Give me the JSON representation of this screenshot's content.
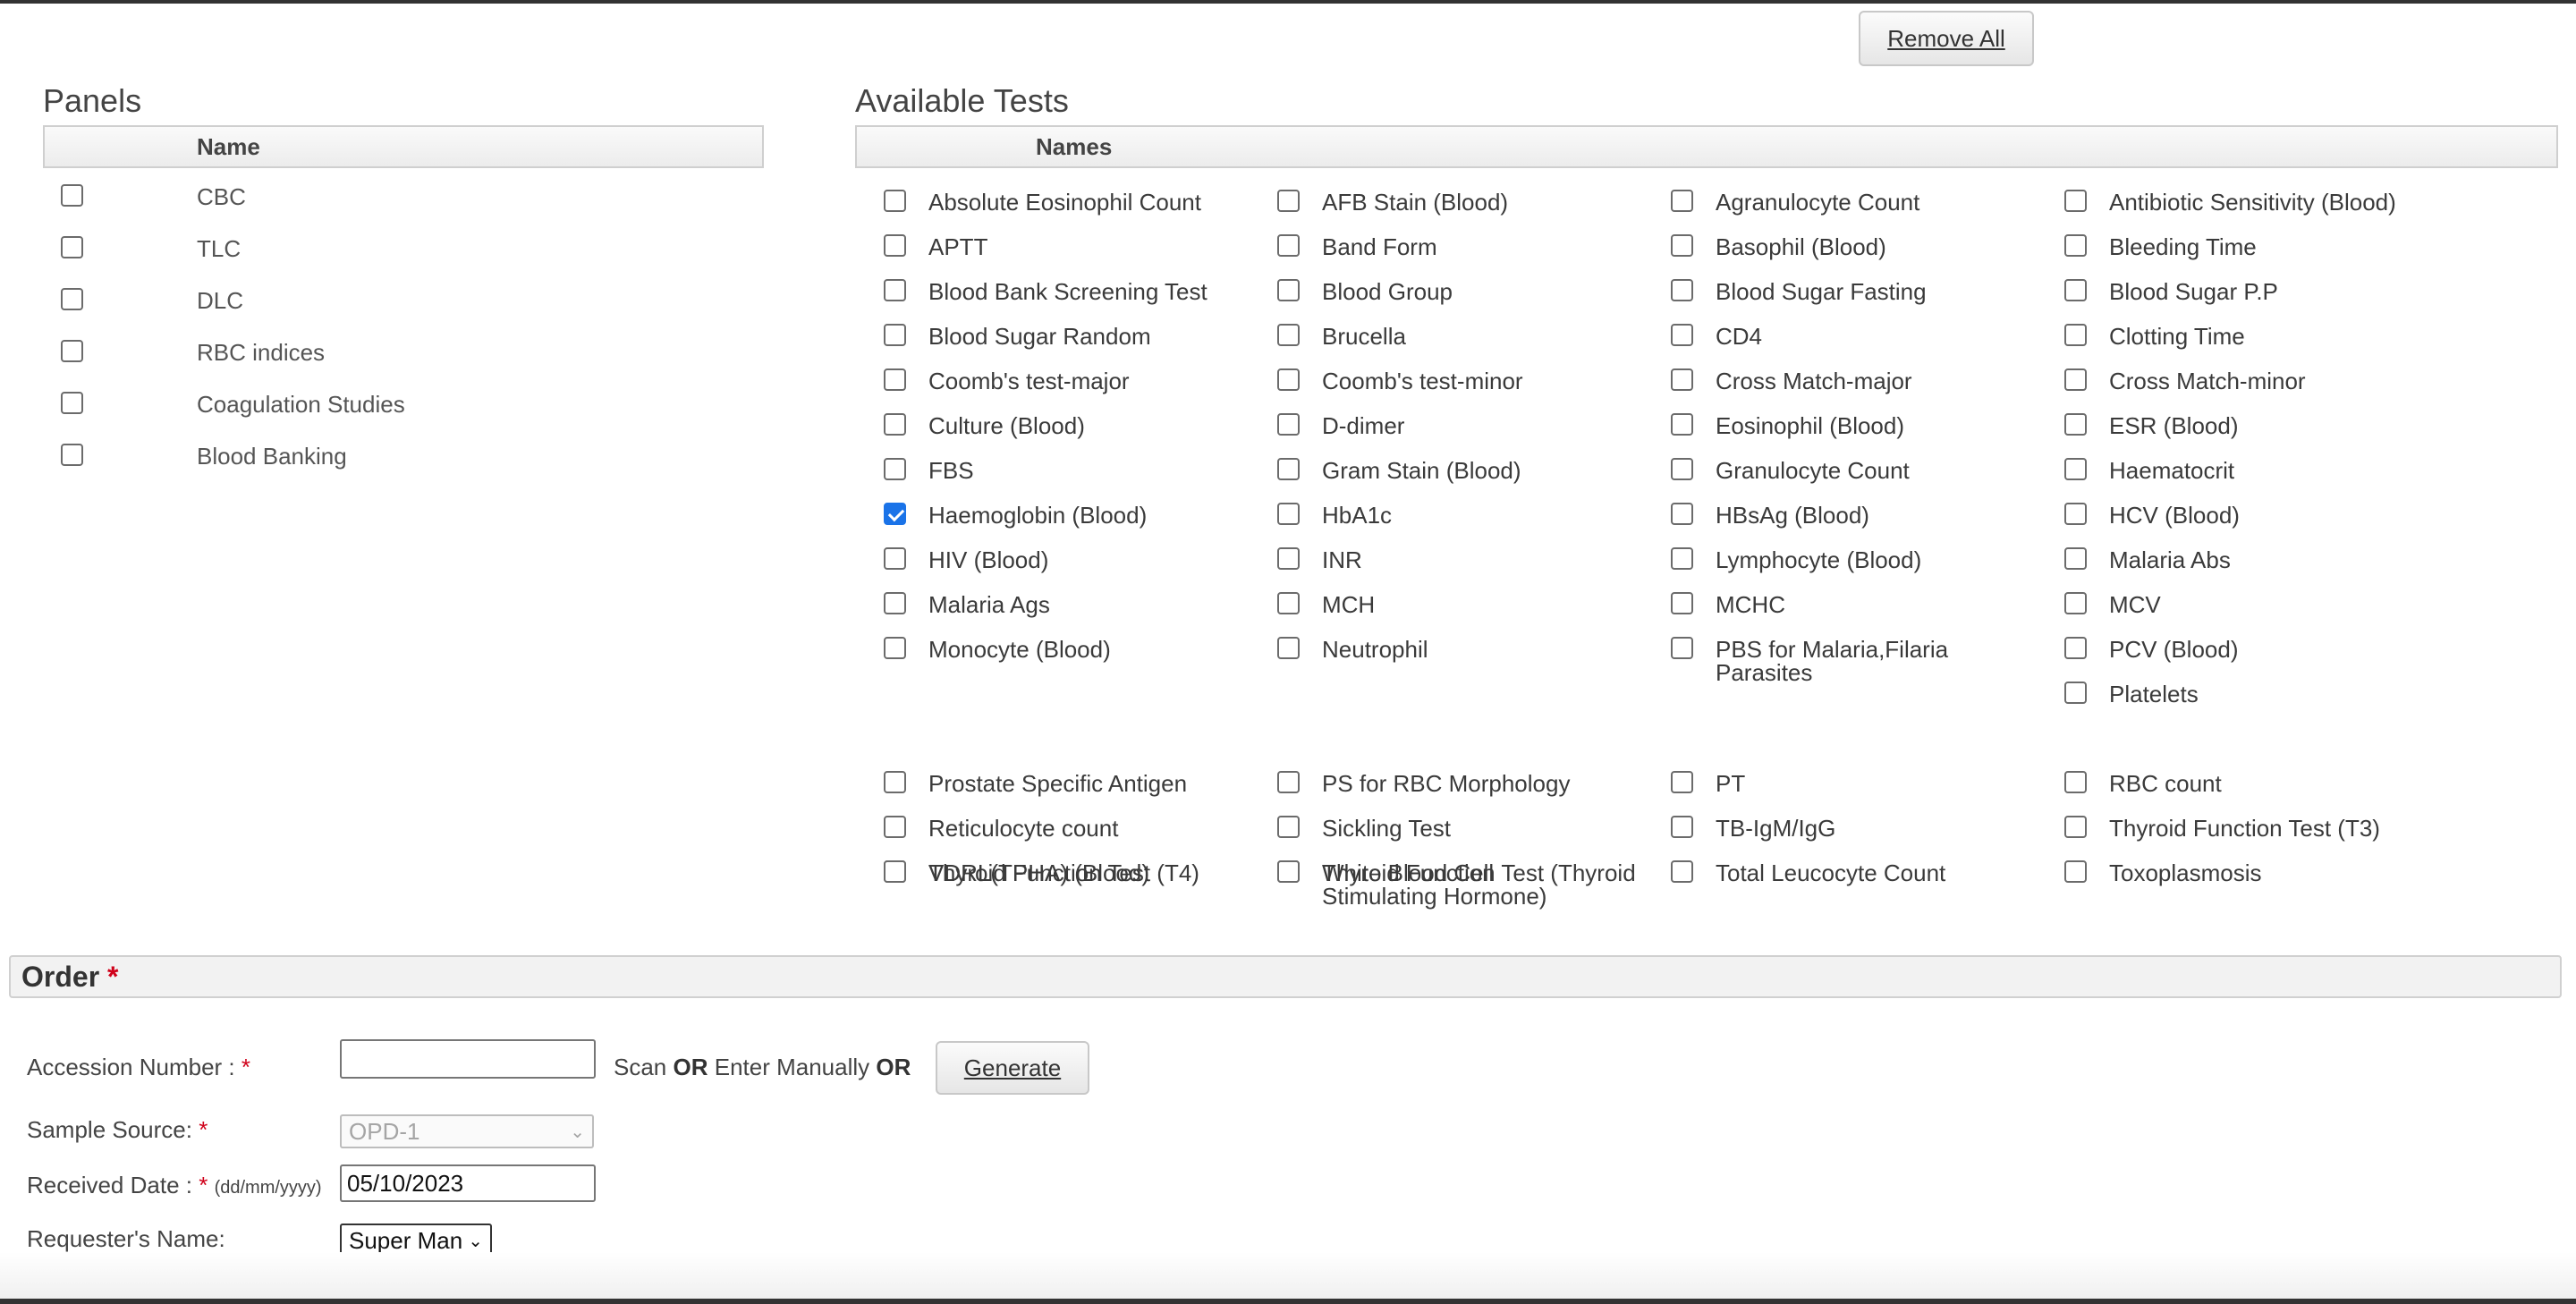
{
  "toolbar": {
    "remove_all_label": "Remove All"
  },
  "panels": {
    "title": "Panels",
    "column_header": "Name",
    "items": [
      {
        "label": "CBC",
        "checked": false
      },
      {
        "label": "TLC",
        "checked": false
      },
      {
        "label": "DLC",
        "checked": false
      },
      {
        "label": "RBC indices",
        "checked": false
      },
      {
        "label": "Coagulation Studies",
        "checked": false
      },
      {
        "label": "Blood Banking",
        "checked": false
      }
    ]
  },
  "tests": {
    "title": "Available Tests",
    "column_header": "Names",
    "items": [
      {
        "label": "Absolute Eosinophil Count",
        "checked": false
      },
      {
        "label": "AFB Stain (Blood)",
        "checked": false
      },
      {
        "label": "Agranulocyte Count",
        "checked": false
      },
      {
        "label": "Antibiotic Sensitivity (Blood)",
        "checked": false
      },
      {
        "label": "APTT",
        "checked": false
      },
      {
        "label": "Band Form",
        "checked": false
      },
      {
        "label": "Basophil (Blood)",
        "checked": false
      },
      {
        "label": "Bleeding Time",
        "checked": false
      },
      {
        "label": "Blood Bank Screening Test",
        "checked": false
      },
      {
        "label": "Blood Group",
        "checked": false
      },
      {
        "label": "Blood Sugar Fasting",
        "checked": false
      },
      {
        "label": "Blood Sugar P.P",
        "checked": false
      },
      {
        "label": "Blood Sugar Random",
        "checked": false
      },
      {
        "label": "Brucella",
        "checked": false
      },
      {
        "label": "CD4",
        "checked": false
      },
      {
        "label": "Clotting Time",
        "checked": false
      },
      {
        "label": "Coomb's test-major",
        "checked": false
      },
      {
        "label": "Coomb's test-minor",
        "checked": false
      },
      {
        "label": "Cross Match-major",
        "checked": false
      },
      {
        "label": "Cross Match-minor",
        "checked": false
      },
      {
        "label": "Culture (Blood)",
        "checked": false
      },
      {
        "label": "D-dimer",
        "checked": false
      },
      {
        "label": "Eosinophil (Blood)",
        "checked": false
      },
      {
        "label": "ESR (Blood)",
        "checked": false
      },
      {
        "label": "FBS",
        "checked": false
      },
      {
        "label": "Gram Stain (Blood)",
        "checked": false
      },
      {
        "label": "Granulocyte Count",
        "checked": false
      },
      {
        "label": "Haematocrit",
        "checked": false
      },
      {
        "label": "Haemoglobin (Blood)",
        "checked": true
      },
      {
        "label": "HbA1c",
        "checked": false
      },
      {
        "label": "HBsAg (Blood)",
        "checked": false
      },
      {
        "label": "HCV (Blood)",
        "checked": false
      },
      {
        "label": "HIV (Blood)",
        "checked": false
      },
      {
        "label": "INR",
        "checked": false
      },
      {
        "label": "Lymphocyte (Blood)",
        "checked": false
      },
      {
        "label": "Malaria Abs",
        "checked": false
      },
      {
        "label": "Malaria Ags",
        "checked": false
      },
      {
        "label": "MCH",
        "checked": false
      },
      {
        "label": "MCHC",
        "checked": false
      },
      {
        "label": "MCV",
        "checked": false
      },
      {
        "label": "Monocyte (Blood)",
        "checked": false
      },
      {
        "label": "Neutrophil",
        "checked": false
      },
      {
        "label": "PBS for Malaria,Filaria Parasites",
        "checked": false
      },
      {
        "label": "PCV (Blood)",
        "checked": false
      },
      {
        "label": "Platelets",
        "checked": false
      },
      {
        "label": "Prostate Specific Antigen",
        "checked": false
      },
      {
        "label": "PS for RBC Morphology",
        "checked": false
      },
      {
        "label": "PT",
        "checked": false
      },
      {
        "label": "RBC count",
        "checked": false
      },
      {
        "label": "Reticulocyte count",
        "checked": false
      },
      {
        "label": "Sickling Test",
        "checked": false
      },
      {
        "label": "TB-IgM/IgG",
        "checked": false
      },
      {
        "label": "Thyroid Function Test (T3)",
        "checked": false
      },
      {
        "label": "Thyroid Function Test (T4)",
        "checked": false
      },
      {
        "label": "Thyroid Function Test (Thyroid Stimulating Hormone)",
        "checked": false
      },
      {
        "label": "Total Leucocyte Count",
        "checked": false
      },
      {
        "label": "Toxoplasmosis",
        "checked": false
      },
      {
        "label": "VDRL(TPHA) (Blood)",
        "checked": false
      },
      {
        "label": "White Blood Cell",
        "checked": false
      }
    ]
  },
  "order": {
    "title": "Order",
    "required_mark": "*",
    "accession": {
      "label": "Accession Number : ",
      "value": "",
      "scan_text": "Scan",
      "or_text": "OR",
      "manual_text": "Enter Manually",
      "generate_label": "Generate"
    },
    "sample_source": {
      "label": "Sample Source: ",
      "value": "OPD-1"
    },
    "received_date": {
      "label": "Received Date : ",
      "format_hint": "(dd/mm/yyyy)",
      "value": "05/10/2023"
    },
    "requester": {
      "label": "Requester's Name:",
      "value": "Super Man"
    }
  },
  "colors": {
    "checkbox_checked": "#1a73e8",
    "required": "#d0021b"
  }
}
